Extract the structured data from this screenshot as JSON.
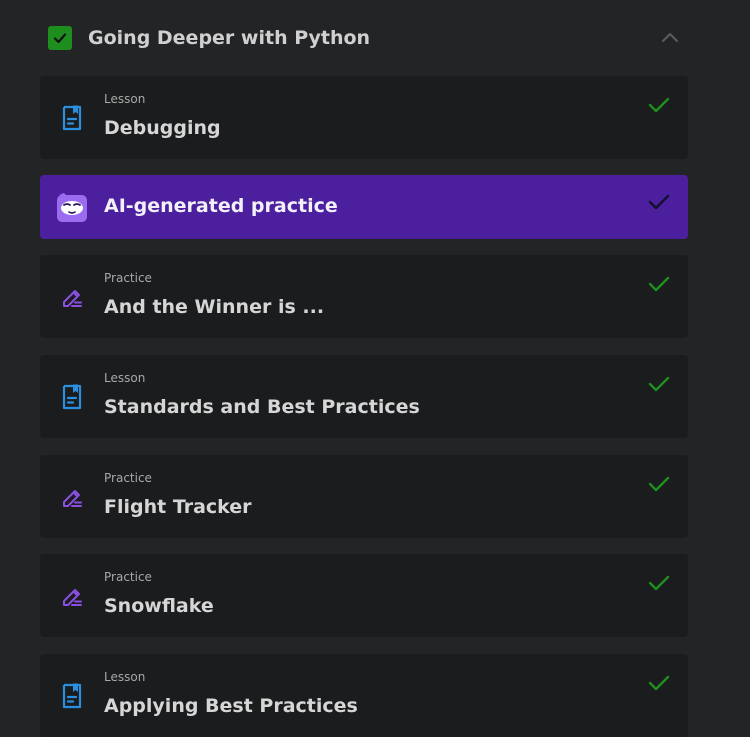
{
  "module": {
    "title": "Going Deeper with Python",
    "completed": true,
    "expanded": true
  },
  "colors": {
    "completed_green": "#1e8f1e",
    "active_purple": "#4b1f9e",
    "lesson_blue": "#2a8fe0",
    "practice_purple": "#8a4ee0"
  },
  "items": [
    {
      "kind": "Lesson",
      "title": "Debugging",
      "icon": "lesson-document-icon",
      "completed": true
    },
    {
      "kind": "",
      "title": "AI-generated practice",
      "icon": "ai-mascot-icon",
      "completed": true,
      "selected": true
    },
    {
      "kind": "Practice",
      "title": "And the Winner is ...",
      "icon": "practice-pencil-icon",
      "completed": true
    },
    {
      "kind": "Lesson",
      "title": "Standards and Best Practices",
      "icon": "lesson-document-icon",
      "completed": true
    },
    {
      "kind": "Practice",
      "title": "Flight Tracker",
      "icon": "practice-pencil-icon",
      "completed": true
    },
    {
      "kind": "Practice",
      "title": "Snowflake",
      "icon": "practice-pencil-icon",
      "completed": true
    },
    {
      "kind": "Lesson",
      "title": "Applying Best Practices",
      "icon": "lesson-document-icon",
      "completed": true
    }
  ]
}
